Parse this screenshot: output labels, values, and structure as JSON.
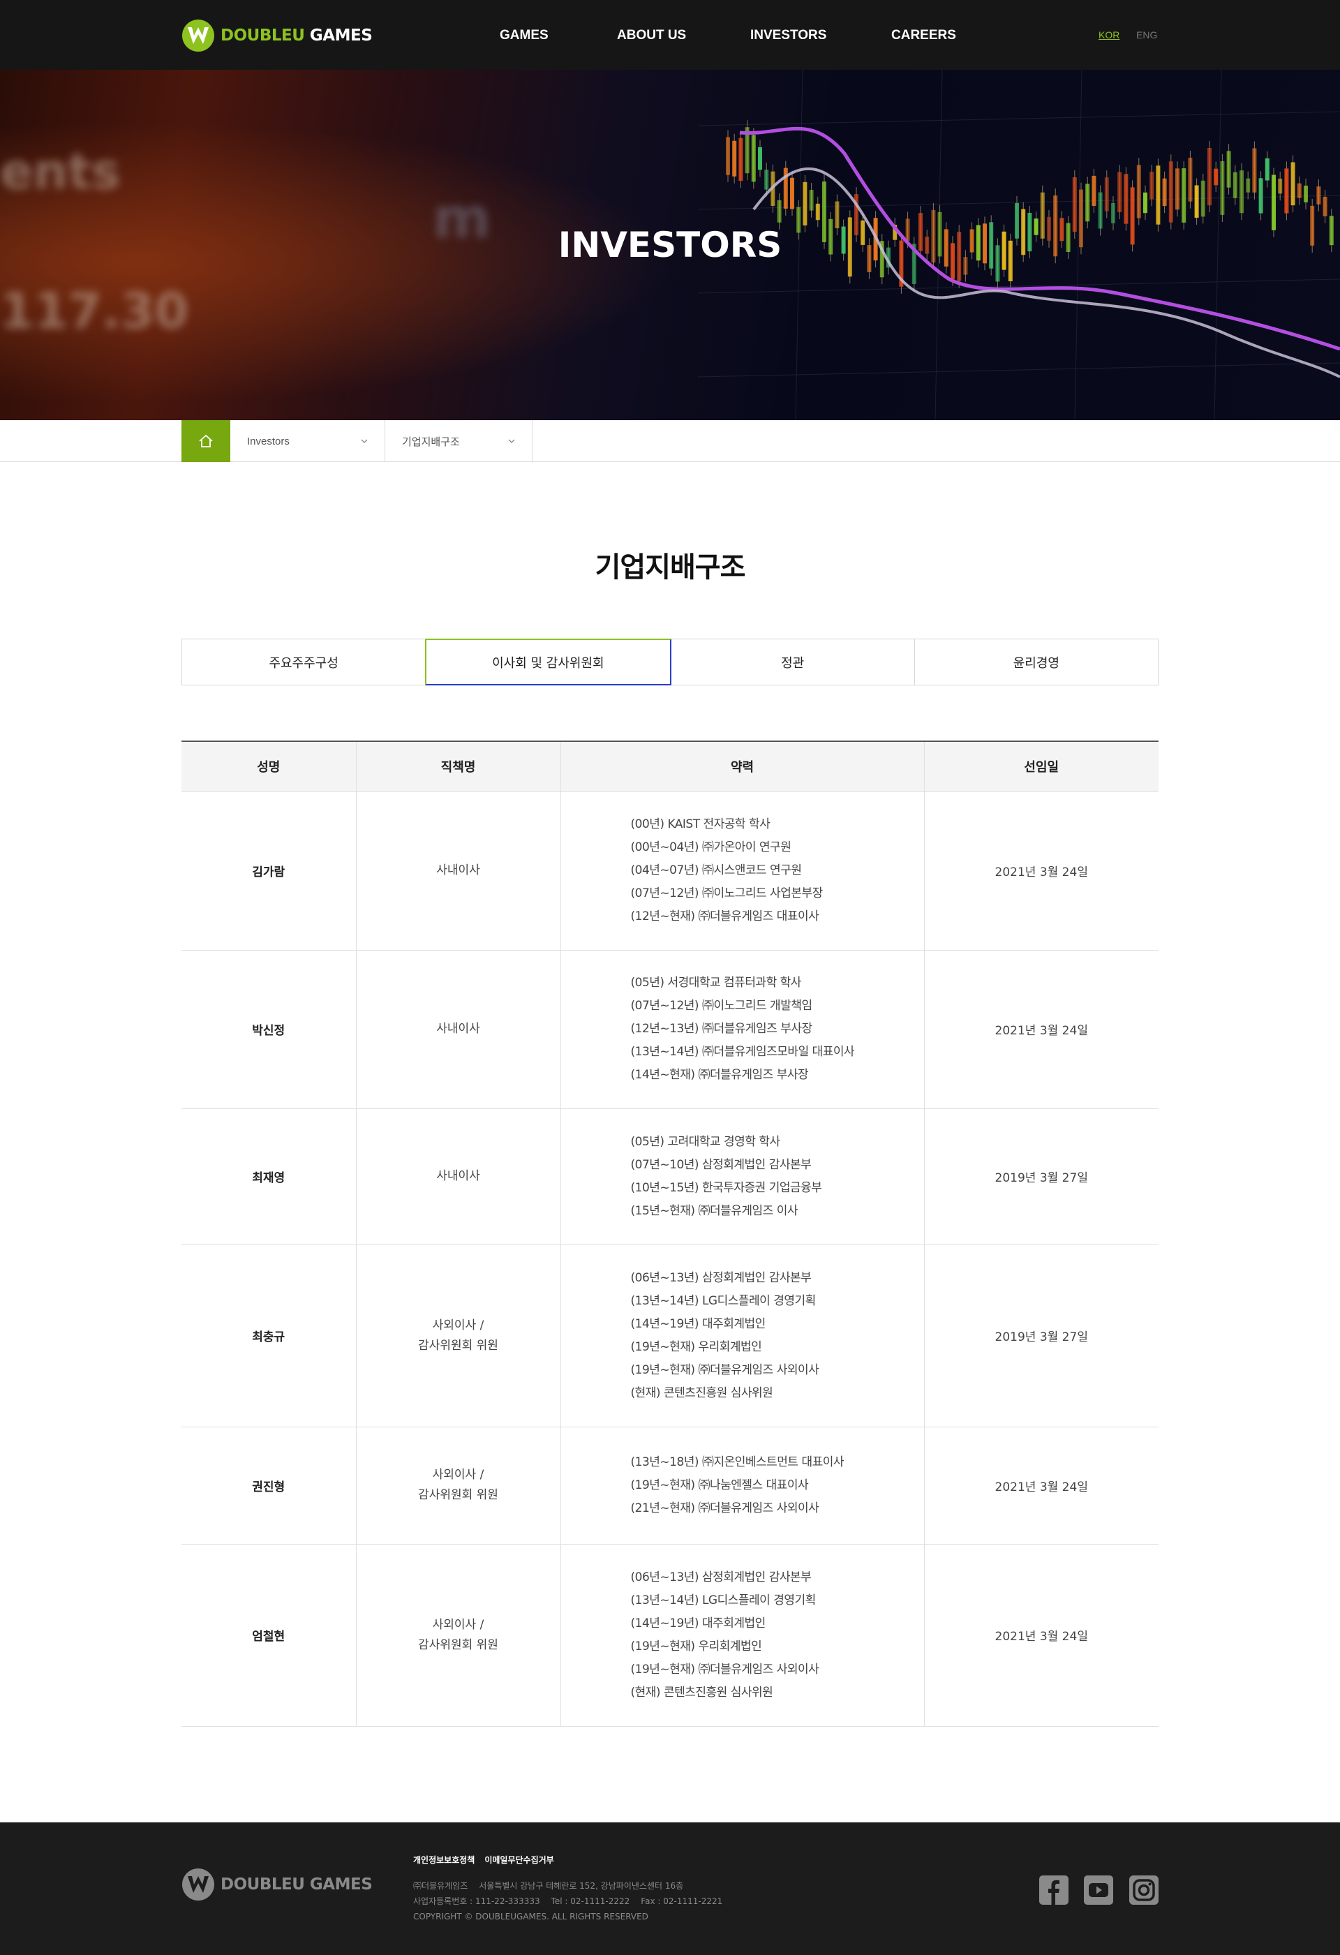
{
  "header": {
    "logo_text_1": "DOUBLEU",
    "logo_text_2": " GAMES",
    "nav": [
      "GAMES",
      "ABOUT US",
      "INVESTORS",
      "CAREERS"
    ],
    "lang_kor": "KOR",
    "lang_eng": "ENG"
  },
  "hero": {
    "title": "INVESTORS"
  },
  "breadcrumb": {
    "home_icon": "home-icon",
    "level1": "Investors",
    "level2": "기업지배구조"
  },
  "page": {
    "title": "기업지배구조"
  },
  "tabs": [
    {
      "label": "주요주주구성",
      "active": false
    },
    {
      "label": "이사회 및 감사위원회",
      "active": true
    },
    {
      "label": "정관",
      "active": false
    },
    {
      "label": "윤리경영",
      "active": false
    }
  ],
  "table": {
    "headers": [
      "성명",
      "직책명",
      "약력",
      "선임일"
    ],
    "rows": [
      {
        "name": "김가람",
        "position": [
          "사내이사"
        ],
        "career": [
          "(00년) KAIST 전자공학 학사",
          "(00년~04년) ㈜가온아이 연구원",
          "(04년~07년) ㈜시스앤코드 연구원",
          "(07년~12년) ㈜이노그리드 사업본부장",
          "(12년~현재) ㈜더블유게임즈 대표이사"
        ],
        "date": "2021년 3월 24일"
      },
      {
        "name": "박신정",
        "position": [
          "사내이사"
        ],
        "career": [
          "(05년) 서경대학교 컴퓨터과학 학사",
          "(07년~12년) ㈜이노그리드 개발책임",
          "(12년~13년) ㈜더블유게임즈 부사장",
          "(13년~14년) ㈜더블유게임즈모바일 대표이사",
          "(14년~현재) ㈜더블유게임즈 부사장"
        ],
        "date": "2021년 3월 24일"
      },
      {
        "name": "최재영",
        "position": [
          "사내이사"
        ],
        "career": [
          "(05년) 고려대학교 경영학 학사",
          "(07년~10년) 삼정회계법인 감사본부",
          "(10년~15년) 한국투자증권 기업금융부",
          "(15년~현재) ㈜더블유게임즈 이사"
        ],
        "date": "2019년 3월 27일"
      },
      {
        "name": "최충규",
        "position": [
          "사외이사 /",
          "감사위원회 위원"
        ],
        "career": [
          "(06년~13년) 삼정회계법인 감사본부",
          "(13년~14년) LG디스플레이 경영기획",
          "(14년~19년) 대주회계법인",
          "(19년~현재) 우리회계법인",
          "(19년~현재) ㈜더블유게임즈 사외이사",
          "(현재) 콘텐츠진흥원 심사위원"
        ],
        "date": "2019년 3월 27일"
      },
      {
        "name": "권진형",
        "position": [
          "사외이사 /",
          "감사위원회 위원"
        ],
        "career": [
          "(13년~18년) ㈜지온인베스트먼트 대표이사",
          "(19년~현재) ㈜나눔엔젤스 대표이사",
          "(21년~현재) ㈜더블유게임즈 사외이사"
        ],
        "date": "2021년 3월 24일"
      },
      {
        "name": "엄철현",
        "position": [
          "사외이사 /",
          "감사위원회 위원"
        ],
        "career": [
          "(06년~13년) 삼정회계법인 감사본부",
          "(13년~14년) LG디스플레이 경영기획",
          "(14년~19년) 대주회계법인",
          "(19년~현재) 우리회계법인",
          "(19년~현재) ㈜더블유게임즈 사외이사",
          "(현재) 콘텐츠진흥원 심사위원"
        ],
        "date": "2021년 3월 24일"
      }
    ]
  },
  "footer": {
    "links": [
      "개인정보보호정책",
      "이메일무단수집거부"
    ],
    "company": "㈜더블유게임즈",
    "address": "서울특별시 강남구 테헤란로 152, 강남파이낸스센터 16층",
    "biz_no": "사업자등록번호 : 111-22-333333",
    "tel": "Tel : 02-1111-2222",
    "fax": "Fax : 02-1111-2221",
    "copyright": "COPYRIGHT © DOUBLEUGAMES. ALL RIGHTS RESERVED",
    "sns": [
      "facebook-icon",
      "youtube-icon",
      "instagram-icon"
    ]
  },
  "colors": {
    "brand_green": "#8dc21f",
    "home_green": "#78a80f",
    "header_bg": "#161616",
    "footer_bg": "#1c1c1c",
    "active_tab_border": "#2b3fc9"
  }
}
